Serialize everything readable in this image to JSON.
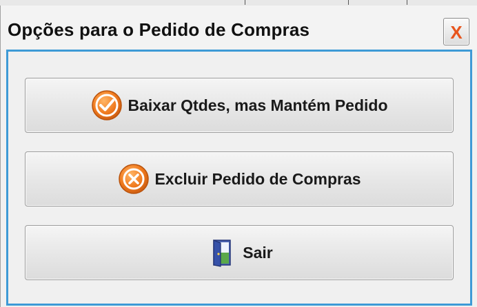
{
  "dialog": {
    "title": "Opções para o Pedido de Compras",
    "close_label": "X"
  },
  "buttons": [
    {
      "label": "Baixar Qtdes, mas Mantém Pedido",
      "icon": "check-circle-icon"
    },
    {
      "label": "Excluir Pedido de Compras",
      "icon": "x-circle-icon"
    },
    {
      "label": "Sair",
      "icon": "door-exit-icon"
    }
  ],
  "colors": {
    "accent_blue": "#3d9ad6",
    "icon_orange": "#f07a1e",
    "close_red": "#e8541c"
  }
}
